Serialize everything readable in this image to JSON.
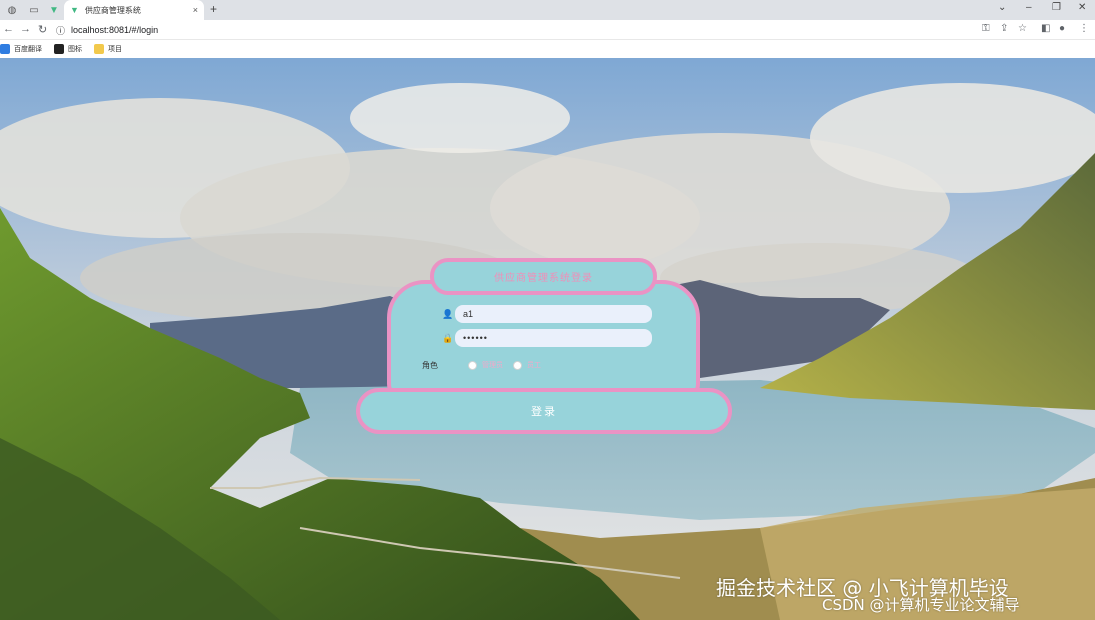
{
  "browser": {
    "tabs": {
      "active_title": "供应商管理系统",
      "close_glyph": "×",
      "new_tab_glyph": "+"
    },
    "window_controls": {
      "dropdown": "⌄",
      "minimize": "–",
      "restore": "❐",
      "close": "✕"
    },
    "nav": {
      "back": "←",
      "forward": "→",
      "reload": "↻"
    },
    "address": {
      "info_glyph": "ⓘ",
      "url": "localhost:8081/#/login"
    },
    "toolbar_icons": [
      "key-icon",
      "share-icon",
      "star-icon",
      "sidepanel-icon",
      "profile-icon",
      "menu-icon"
    ],
    "bookmarks": [
      {
        "label": "百度翻译",
        "color": "#2f7de1"
      },
      {
        "label": "图标",
        "color": "#222222"
      },
      {
        "label": "项目",
        "color": "#f2c94c"
      }
    ]
  },
  "login": {
    "title": "供应商管理系统登录",
    "username_icon": "👤",
    "username_value": "a1",
    "password_icon": "🔒",
    "password_value": "••••••",
    "role_label": "角色",
    "role_options": [
      "管理员",
      "员工"
    ],
    "submit_label": "登录"
  },
  "watermark": {
    "line1": "掘金技术社区 @ 小飞计算机毕设",
    "line2": "CSDN @计算机专业论文辅导"
  },
  "colors": {
    "panel": "#97d3da",
    "border": "#ea93c4",
    "title_text": "#ef8fb8"
  }
}
